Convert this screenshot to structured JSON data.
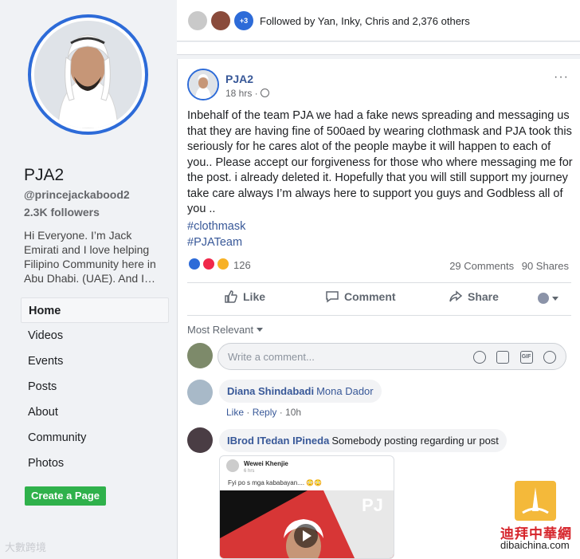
{
  "sidebar": {
    "page_name": "PJA2",
    "handle": "@princejackabood2",
    "followers": "2.3K followers",
    "about": "Hi Everyone. I’m Jack Emirati and I love helping Filipino Community here in Abu Dhabi. (UAE). And I…",
    "nav": [
      "Home",
      "Videos",
      "Events",
      "Posts",
      "About",
      "Community",
      "Photos"
    ],
    "create_page": "Create a Page",
    "watermark": "大數跨境"
  },
  "follow_bar": {
    "plus_count": "+3",
    "text": "Followed by Yan, Inky, Chris and 2,376 others"
  },
  "post": {
    "author": "PJA2",
    "time": "18 hrs ·",
    "body": "Inbehalf of the team PJA we had a fake news spreading and messaging us that they are having fine of 500aed by wearing clothmask and PJA took this seriously for he cares alot of the people maybe it will happen to each of you.. Please accept our forgiveness for those who where messaging me for the post. i already deleted it. Hopefully that you will still support my journey take care always I’m always here to support you guys and Godbless all of you ..",
    "hashtags": [
      "#clothmask",
      "#PJATeam"
    ],
    "reaction_count": "126",
    "comments_count": "29 Comments",
    "shares_count": "90 Shares",
    "actions": {
      "like": "Like",
      "comment": "Comment",
      "share": "Share"
    },
    "sort_label": "Most Relevant",
    "comment_placeholder": "Write a comment..."
  },
  "comments": [
    {
      "author": "Diana Shindabadi",
      "text": "Mona Dador",
      "like": "Like",
      "reply": "Reply",
      "time": "10h"
    },
    {
      "author": "IBrod ITedan IPineda",
      "text": "Somebody posting regarding ur post"
    }
  ],
  "shared_image": {
    "author": "Wewei Khenjie",
    "sub": "6 hrs",
    "text": "Fyi po s mga kababayan.... 😳😳",
    "logo": "PJ"
  },
  "watermark_right": {
    "cn": "迪拜中華網",
    "url": "dibaichina.com"
  },
  "colors": {
    "accent": "#2d6bd8",
    "link": "#385898",
    "green": "#2fb14b"
  }
}
